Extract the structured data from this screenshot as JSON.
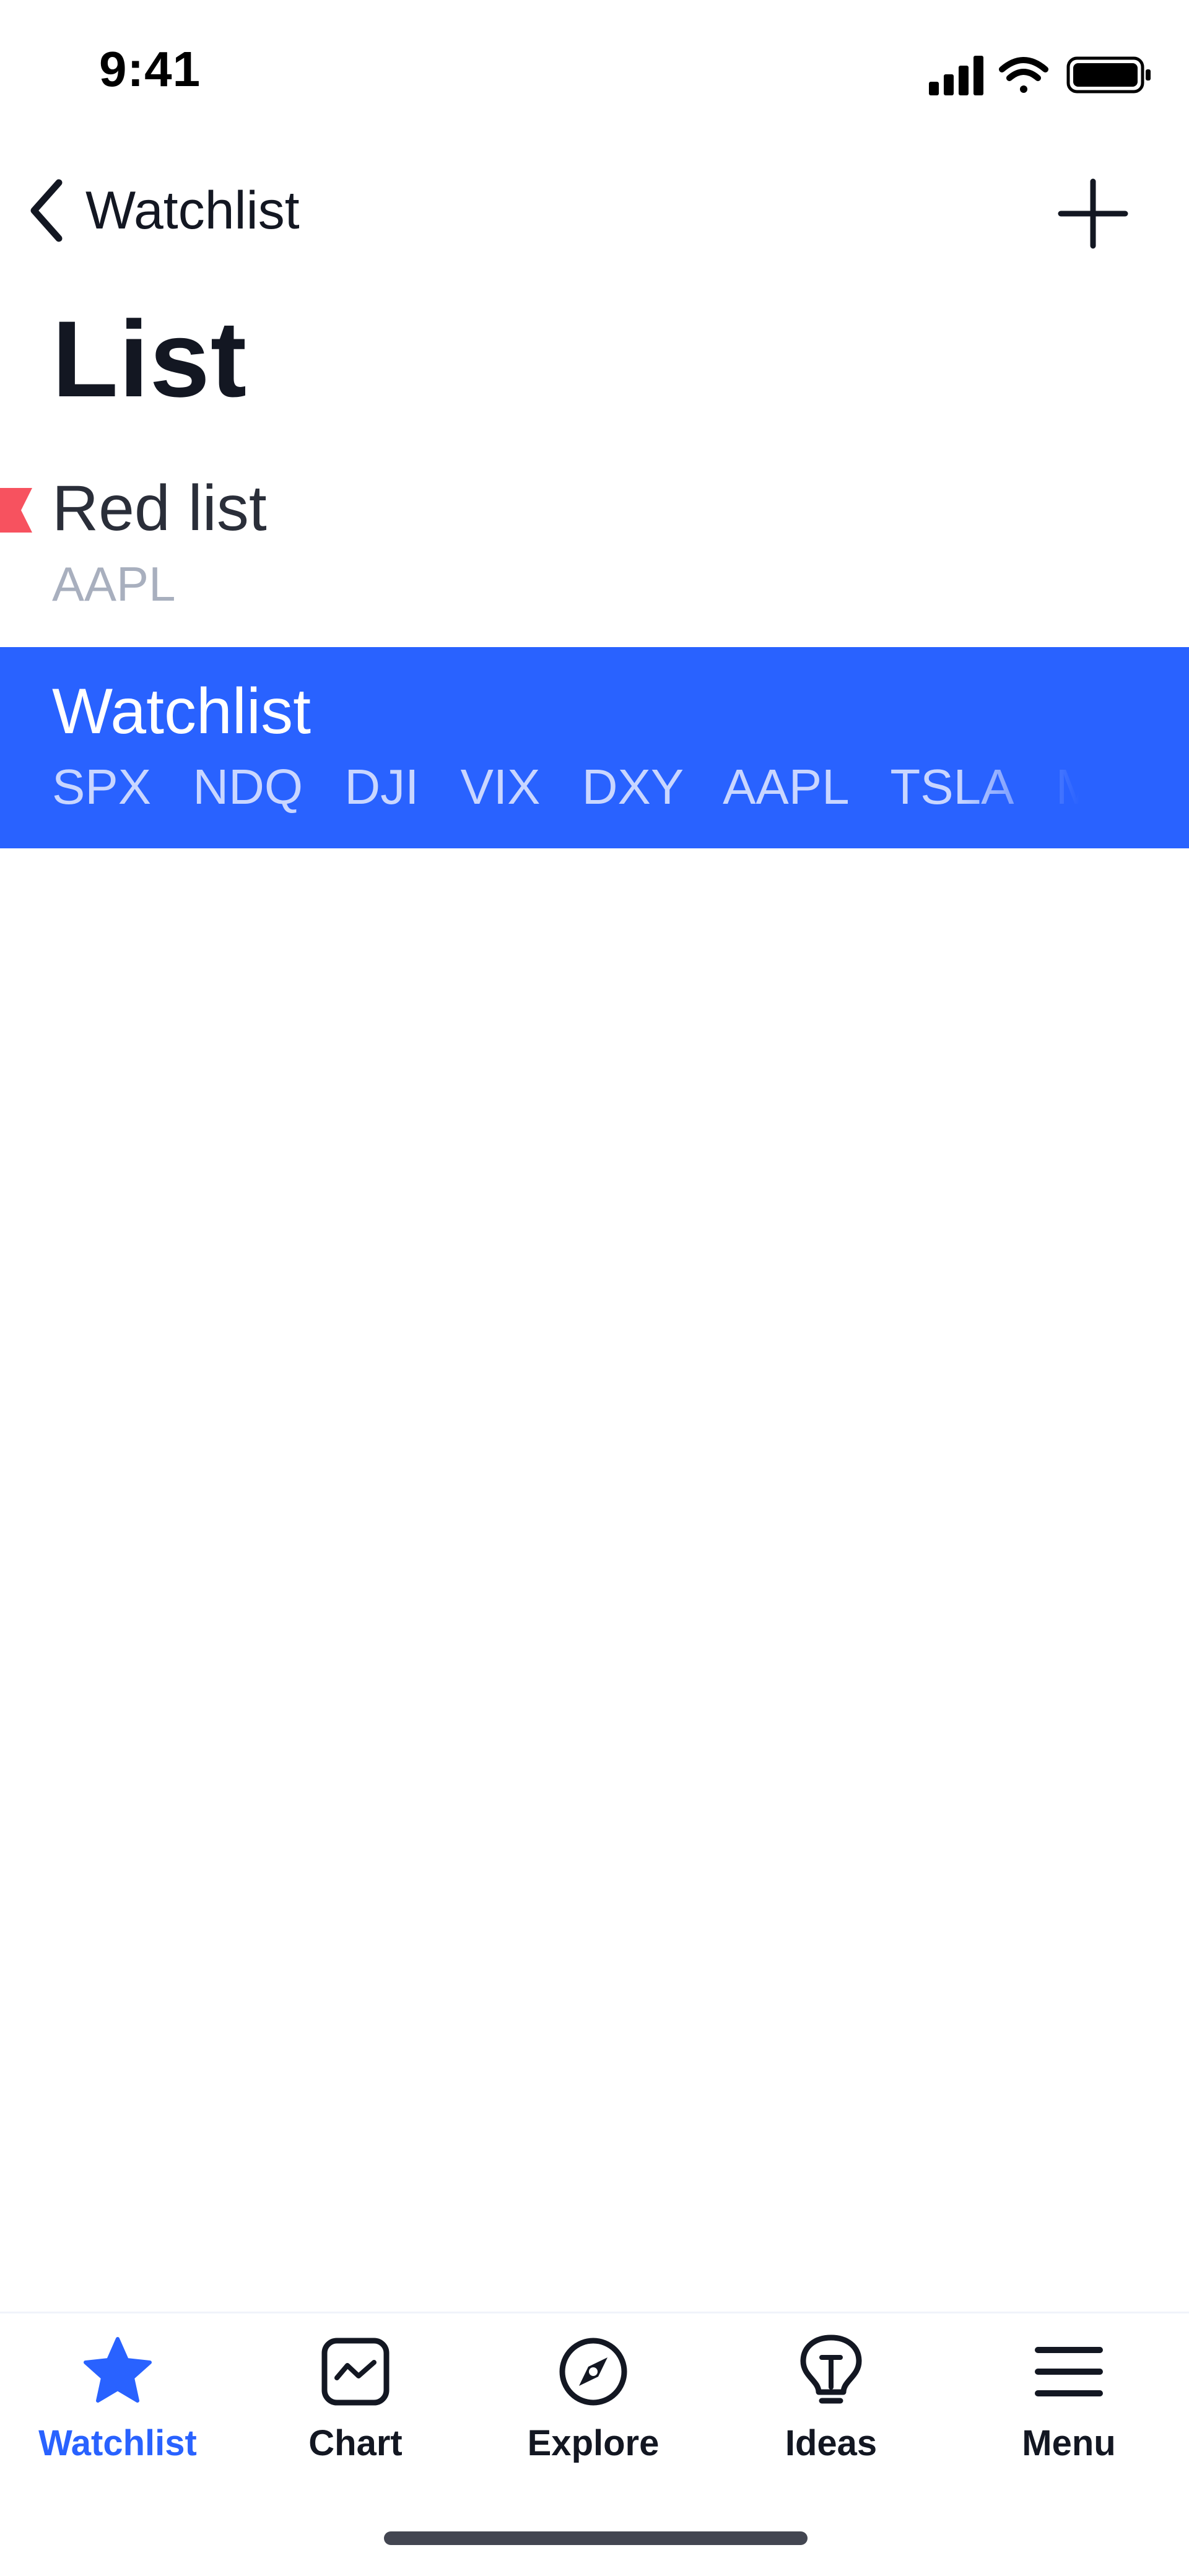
{
  "status_bar": {
    "time": "9:41"
  },
  "nav": {
    "back_label": "Watchlist",
    "add_icon": "plus-icon"
  },
  "page": {
    "title": "List"
  },
  "lists": [
    {
      "name": "Red list",
      "symbols": "AAPL",
      "flag_color": "#f7525f",
      "selected": false
    },
    {
      "name": "Watchlist",
      "symbols": [
        "SPX",
        "NDQ",
        "DJI",
        "VIX",
        "DXY",
        "AAPL",
        "TSLA",
        "MSFT"
      ],
      "selected": true
    }
  ],
  "colors": {
    "accent": "#2962ff",
    "text": "#131722",
    "muted": "#a8afbe",
    "flag": "#f7525f"
  },
  "tabs": [
    {
      "label": "Watchlist",
      "icon": "star-icon",
      "active": true
    },
    {
      "label": "Chart",
      "icon": "chart-icon",
      "active": false
    },
    {
      "label": "Explore",
      "icon": "compass-icon",
      "active": false
    },
    {
      "label": "Ideas",
      "icon": "lightbulb-icon",
      "active": false
    },
    {
      "label": "Menu",
      "icon": "menu-icon",
      "active": false
    }
  ]
}
